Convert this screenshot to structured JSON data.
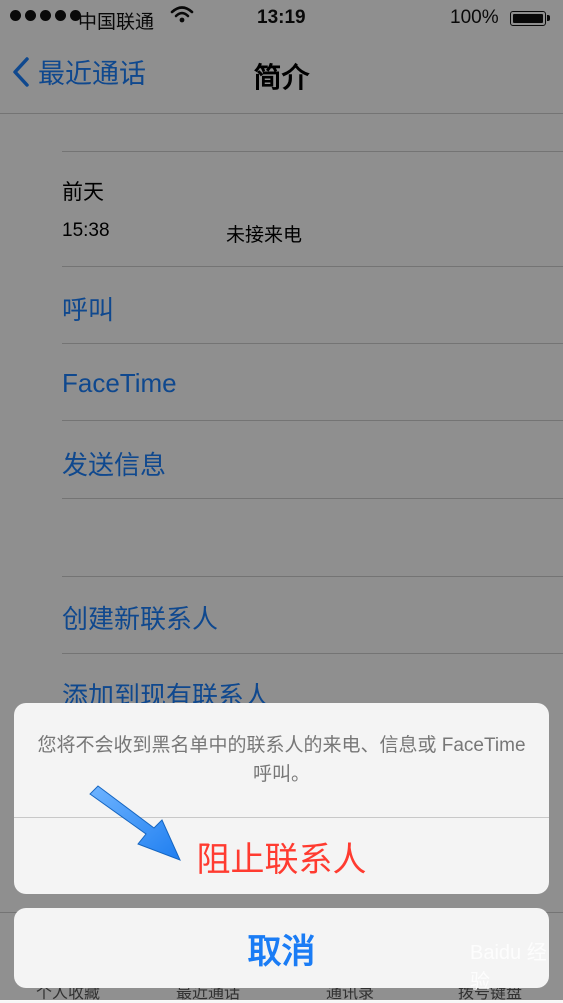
{
  "status_bar": {
    "carrier": "中国联通",
    "time": "13:19",
    "battery": "100%"
  },
  "nav": {
    "back_label": "最近通话",
    "title": "简介"
  },
  "call_history": {
    "date": "前天",
    "time": "15:38",
    "type": "未接来电"
  },
  "actions": {
    "call": "呼叫",
    "facetime": "FaceTime",
    "message": "发送信息",
    "create_contact": "创建新联系人",
    "add_existing": "添加到现有联系人"
  },
  "tab_bar": {
    "items": [
      "个人收藏",
      "最近通话",
      "通讯录",
      "拨号键盘"
    ]
  },
  "action_sheet": {
    "message": "您将不会收到黑名单中的联系人的来电、信息或 FaceTime 呼叫。",
    "block_label": "阻止联系人",
    "cancel_label": "取消"
  },
  "watermark": "Baidu 经验",
  "colors": {
    "accent": "#1a7cf5",
    "destructive": "#ff3b30",
    "annotation_arrow": "#1e7ef0"
  }
}
